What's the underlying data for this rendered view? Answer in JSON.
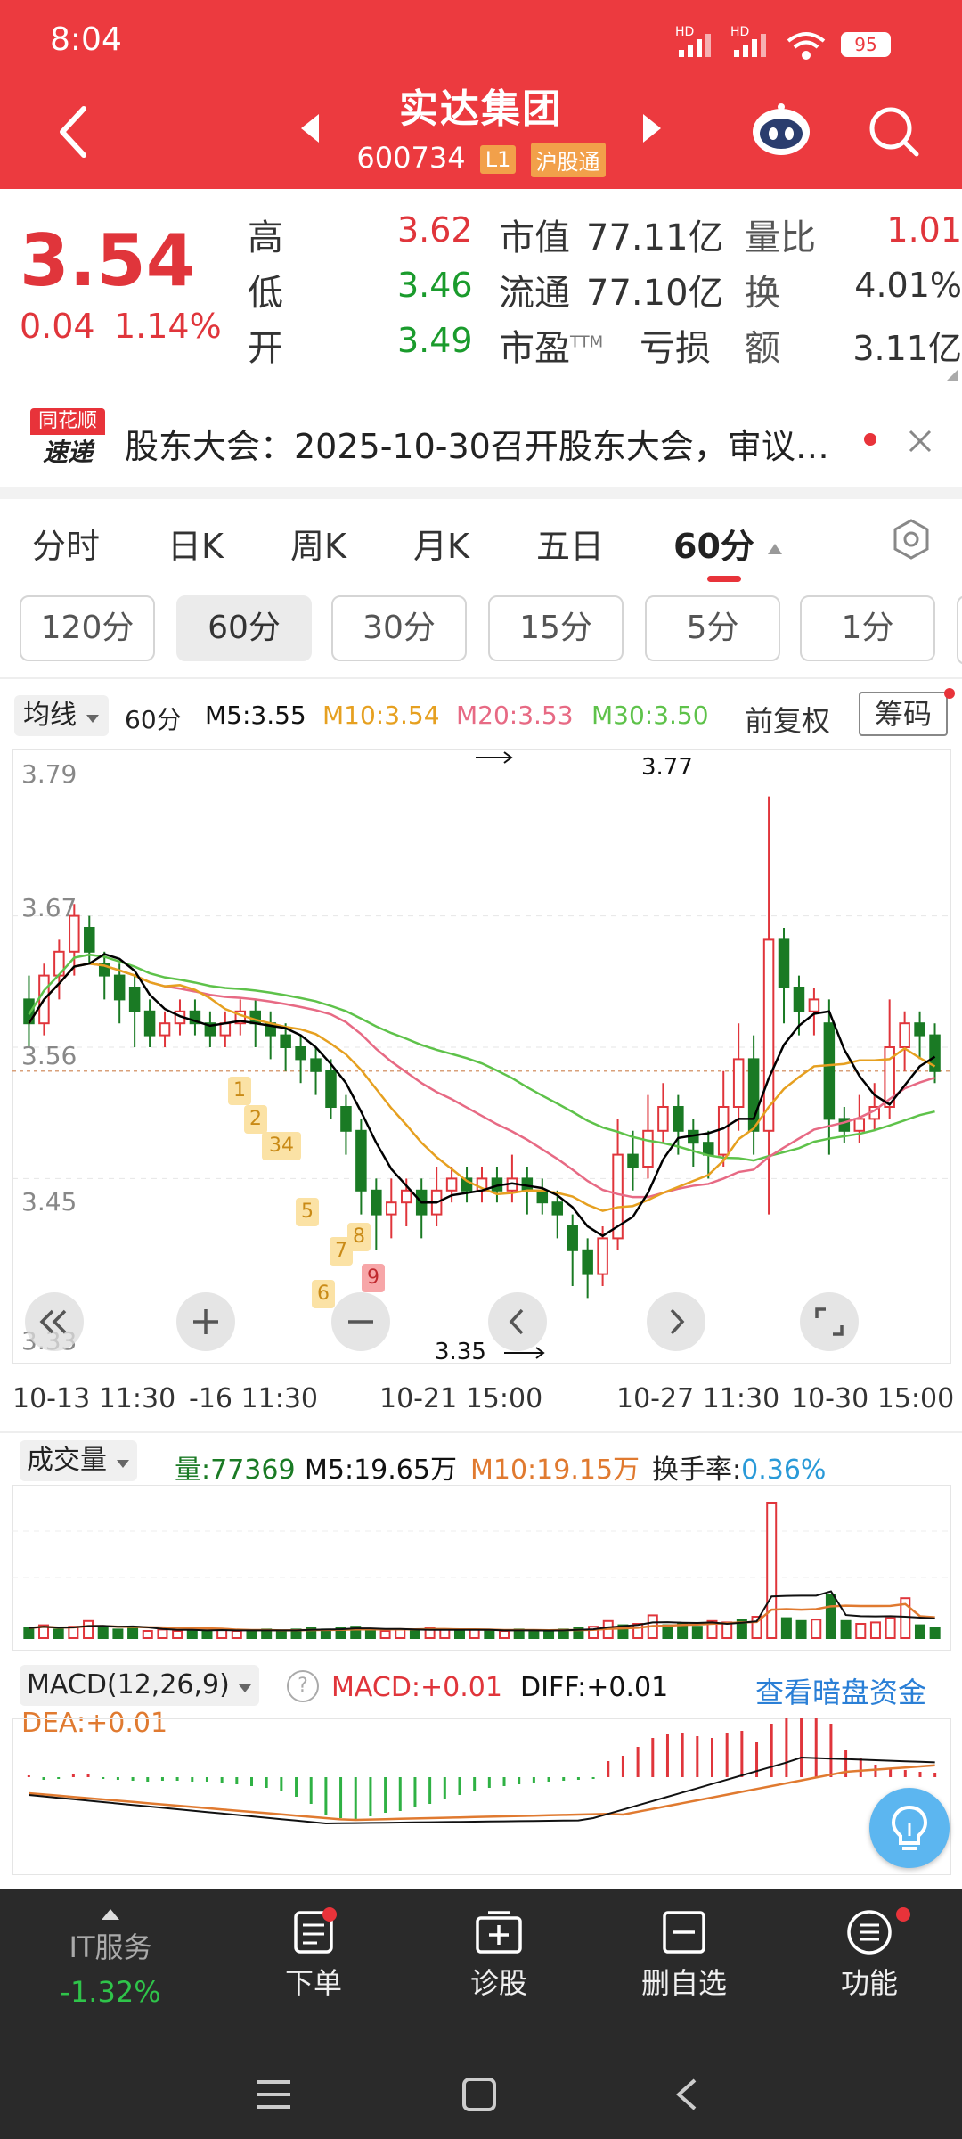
{
  "status": {
    "time": "8:04",
    "hd1": "HD",
    "hd2": "HD",
    "battery": "95"
  },
  "header": {
    "title": "实达集团",
    "code": "600734",
    "level_tag": "L1",
    "connect_tag": "沪股通"
  },
  "quote": {
    "price": "3.54",
    "change": "0.04",
    "change_pct": "1.14%",
    "rows": [
      {
        "l1": "高",
        "v1": "3.62",
        "l2": "市值",
        "v2": "77.11亿",
        "l3": "量比",
        "v3": "1.01"
      },
      {
        "l1": "低",
        "v1": "3.46",
        "l2": "流通",
        "v2": "77.10亿",
        "l3": "换",
        "v3": "4.01%"
      },
      {
        "l1": "开",
        "v1": "3.49",
        "l2": "市盈",
        "l2_sup": "TTM",
        "v2": "亏损",
        "l3": "额",
        "v3": "3.11亿"
      }
    ]
  },
  "news": {
    "logo_top": "同花顺",
    "logo_bottom": "速递",
    "text": "股东大会：2025-10-30召开股东大会，审议…"
  },
  "tabs": [
    "分时",
    "日K",
    "周K",
    "月K",
    "五日",
    "60分"
  ],
  "sub_periods": [
    "120分",
    "60分",
    "30分",
    "15分",
    "5分",
    "1分"
  ],
  "indicators": {
    "selector": "均线",
    "period": "60分",
    "m5": "M5:3.55",
    "m10": "M10:3.54",
    "m20": "M20:3.53",
    "m30": "M30:3.50",
    "adjust": "前复权",
    "chips": "筹码"
  },
  "chart": {
    "y_labels": [
      "3.79",
      "3.67",
      "3.56",
      "3.45",
      "3.33"
    ],
    "high_label": "3.77",
    "low_label": "3.35",
    "signals": [
      "1",
      "2",
      "34",
      "5",
      "6",
      "7",
      "8",
      "9"
    ],
    "x_labels": [
      "10-13 11:30",
      "-16 11:30",
      "10-21 15:00",
      "10-27 11:30",
      "10-30 15:00"
    ]
  },
  "volume": {
    "selector": "成交量",
    "vol": "量:77369",
    "m5": "M5:19.65万",
    "m10": "M10:19.15万",
    "turnover_label": "换手率:",
    "turnover_value": "0.36%"
  },
  "macd": {
    "selector": "MACD(12,26,9)",
    "help": "?",
    "macd": "MACD:+0.01",
    "diff": "DIFF:+0.01",
    "link": "查看暗盘资金",
    "dea": "DEA:+0.01"
  },
  "bottom": {
    "sector": "IT服务",
    "sector_change": "-1.32%",
    "items": [
      "下单",
      "诊股",
      "删自选",
      "功能"
    ]
  },
  "colors": {
    "red": "#ec3a3f",
    "up": "#e0353b",
    "down": "#1a7a24",
    "m5": "#000000",
    "m10": "#e6a020",
    "m20": "#e76a84",
    "m30": "#5ec24a"
  }
}
